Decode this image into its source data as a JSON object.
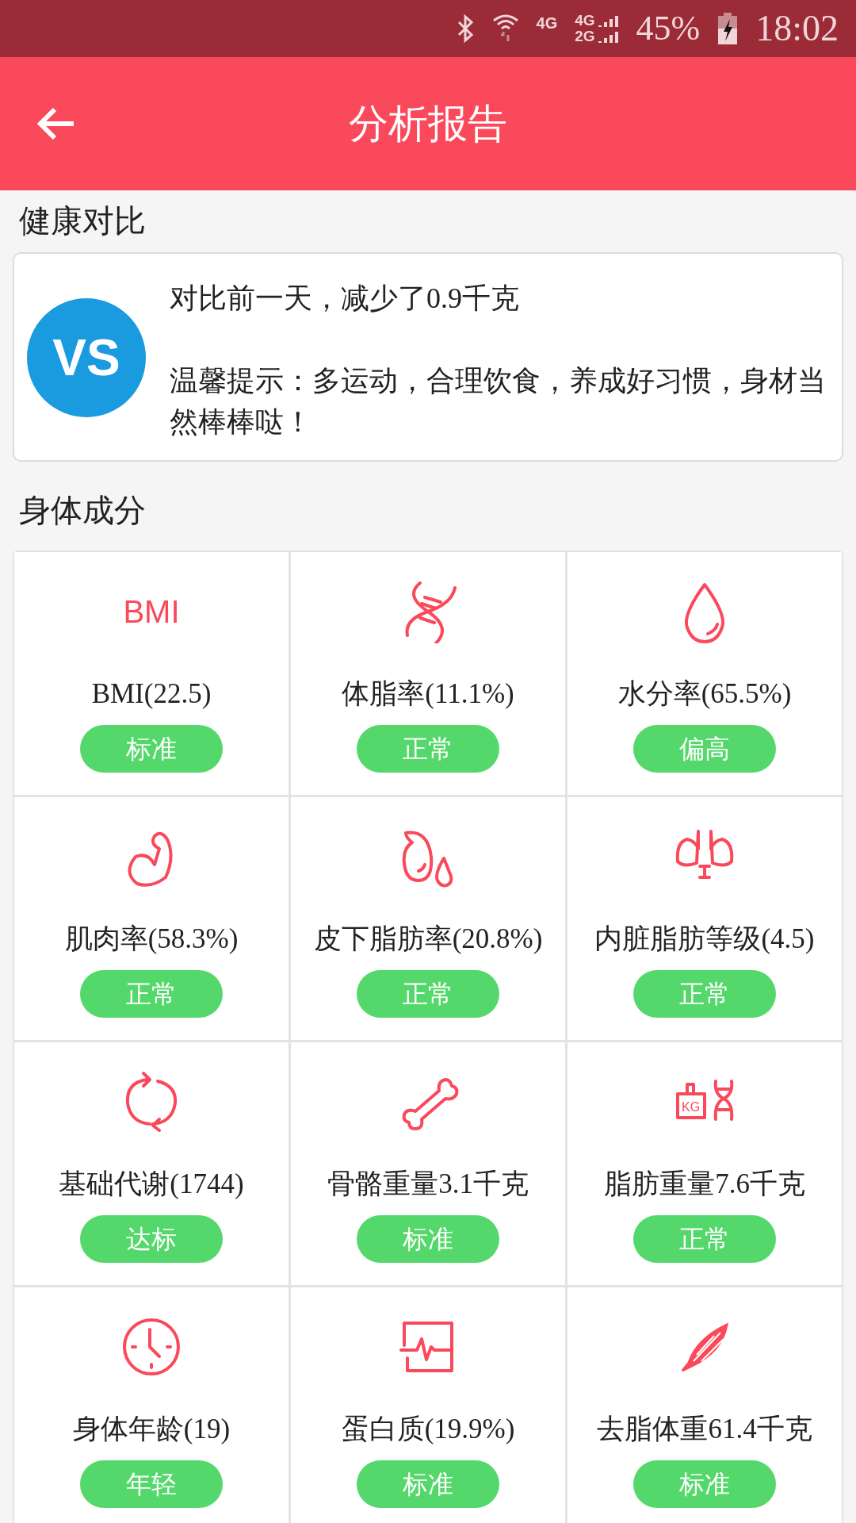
{
  "status_bar": {
    "network_1": "4G",
    "network_2": "4G",
    "network_3": "2G",
    "battery": "45%",
    "time": "18:02"
  },
  "header": {
    "title": "分析报告"
  },
  "comparison": {
    "heading": "健康对比",
    "badge": "VS",
    "result": "对比前一天，减少了0.9千克",
    "tip": "温馨提示：多运动，合理饮食，养成好习惯，身材当然棒棒哒！"
  },
  "composition": {
    "heading": "身体成分",
    "items": [
      {
        "kind": "bmi",
        "icon_text": "BMI",
        "label": "BMI(22.5)",
        "status": "标准"
      },
      {
        "kind": "dna",
        "label": "体脂率(11.1%)",
        "status": "正常"
      },
      {
        "kind": "drop",
        "label": "水分率(65.5%)",
        "status": "偏高"
      },
      {
        "kind": "arm",
        "label": "肌肉率(58.3%)",
        "status": "正常"
      },
      {
        "kind": "drops",
        "label": "皮下脂肪率(20.8%)",
        "status": "正常"
      },
      {
        "kind": "organ",
        "label": "内脏脂肪等级(4.5)",
        "status": "正常"
      },
      {
        "kind": "cycle",
        "label": "基础代谢(1744)",
        "status": "达标"
      },
      {
        "kind": "bone",
        "label": "骨骼重量3.1千克",
        "status": "标准"
      },
      {
        "kind": "weight",
        "icon_text": "KG",
        "label": "脂肪重量7.6千克",
        "status": "正常"
      },
      {
        "kind": "clock",
        "label": "身体年龄(19)",
        "status": "年轻"
      },
      {
        "kind": "monitor",
        "label": "蛋白质(19.9%)",
        "status": "标准"
      },
      {
        "kind": "muscle",
        "label": "去脂体重61.4千克",
        "status": "标准"
      }
    ]
  }
}
